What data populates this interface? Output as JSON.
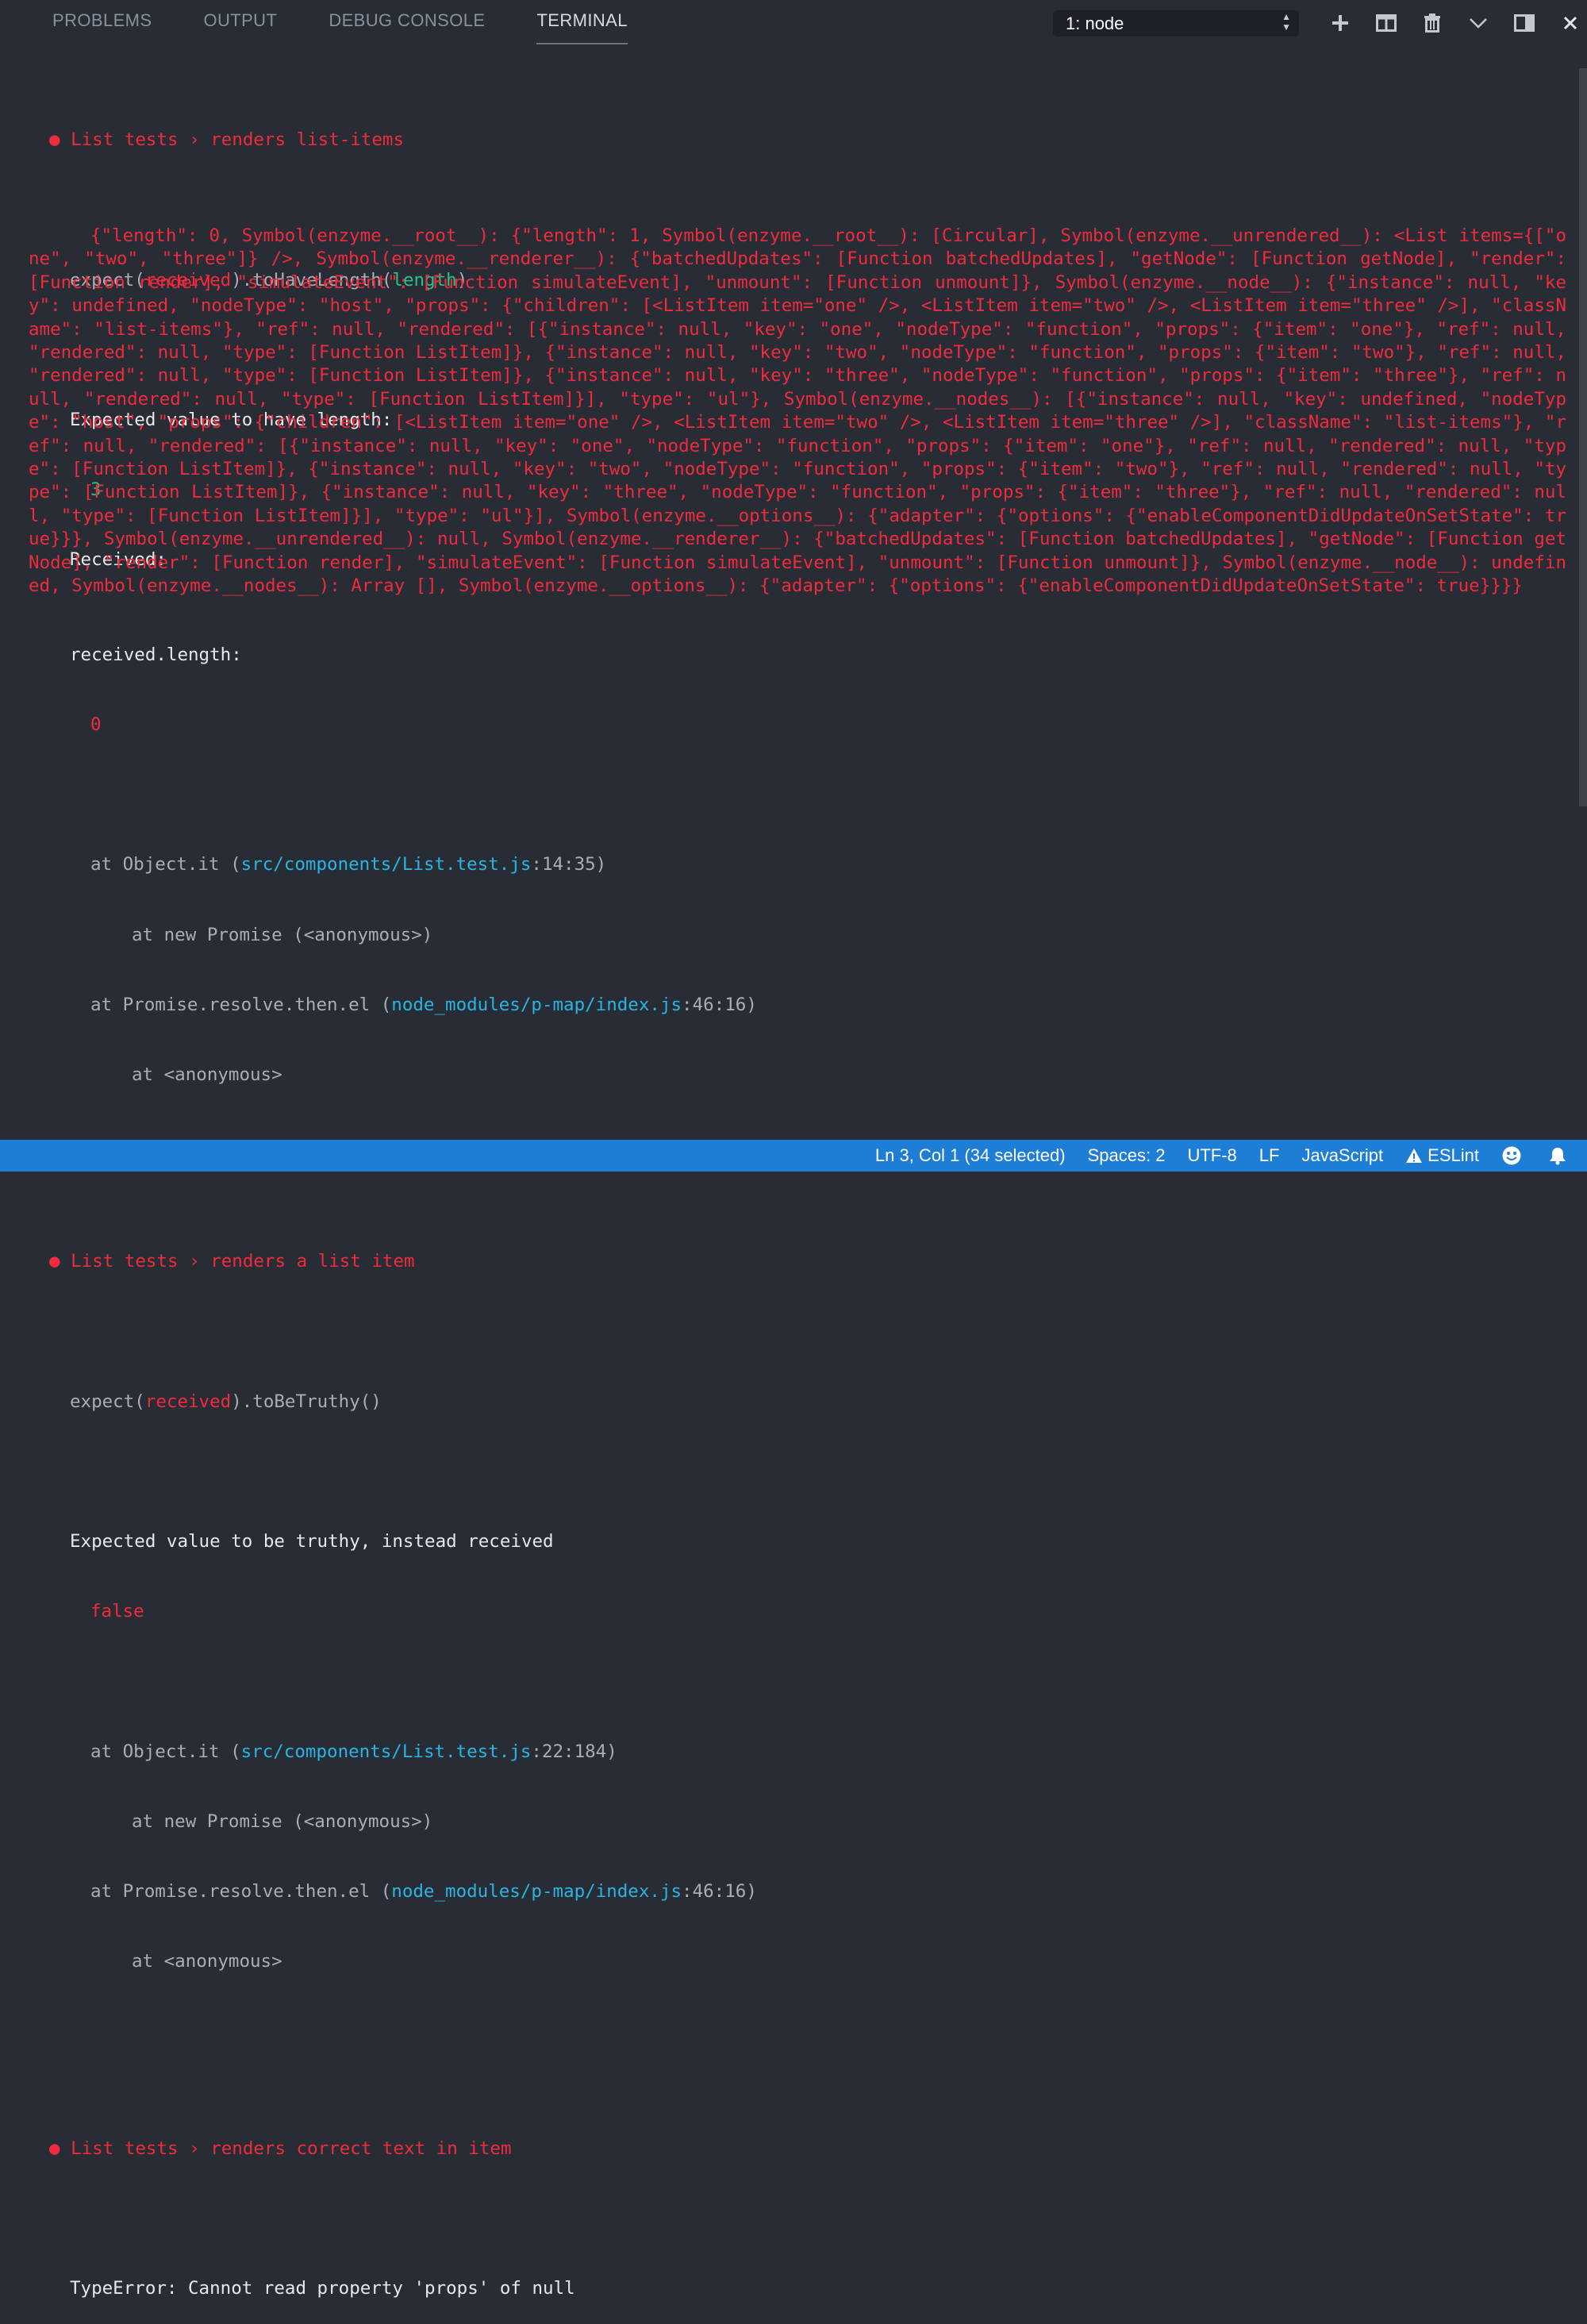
{
  "panel": {
    "tabs": [
      {
        "label": "PROBLEMS"
      },
      {
        "label": "OUTPUT"
      },
      {
        "label": "DEBUG CONSOLE"
      },
      {
        "label": "TERMINAL",
        "active": true
      }
    ],
    "terminal_select": {
      "value": "1: node"
    },
    "actions": [
      "plus-icon",
      "split-terminal-icon",
      "trash-icon",
      "chevron-down-icon",
      "maximize-panel-icon",
      "close-icon"
    ]
  },
  "terminal": {
    "test1": {
      "bullet": "●",
      "title": "List tests › renders list-items",
      "expect_prefix": "expect(",
      "expect_received": "received",
      "expect_mid": ").toHaveLength(",
      "expect_arg": "length",
      "expect_suffix": ")",
      "expected_label": "Expected value to have length:",
      "expected_value": "3",
      "received_label": "Received:",
      "received_value": "{\"length\": 0, Symbol(enzyme.__root__): {\"length\": 1, Symbol(enzyme.__root__): [Circular], Symbol(enzyme.__unrendered__): <List items={[\"one\", \"two\", \"three\"]} />, Symbol(enzyme.__renderer__): {\"batchedUpdates\": [Function batchedUpdates], \"getNode\": [Function getNode], \"render\": [Function render], \"simulateEvent\": [Function simulateEvent], \"unmount\": [Function unmount]}, Symbol(enzyme.__node__): {\"instance\": null, \"key\": undefined, \"nodeType\": \"host\", \"props\": {\"children\": [<ListItem item=\"one\" />, <ListItem item=\"two\" />, <ListItem item=\"three\" />], \"className\": \"list-items\"}, \"ref\": null, \"rendered\": [{\"instance\": null, \"key\": \"one\", \"nodeType\": \"function\", \"props\": {\"item\": \"one\"}, \"ref\": null, \"rendered\": null, \"type\": [Function ListItem]}, {\"instance\": null, \"key\": \"two\", \"nodeType\": \"function\", \"props\": {\"item\": \"two\"}, \"ref\": null, \"rendered\": null, \"type\": [Function ListItem]}, {\"instance\": null, \"key\": \"three\", \"nodeType\": \"function\", \"props\": {\"item\": \"three\"}, \"ref\": null, \"rendered\": null, \"type\": [Function ListItem]}], \"type\": \"ul\"}, Symbol(enzyme.__nodes__): [{\"instance\": null, \"key\": undefined, \"nodeType\": \"host\", \"props\": {\"children\": [<ListItem item=\"one\" />, <ListItem item=\"two\" />, <ListItem item=\"three\" />], \"className\": \"list-items\"}, \"ref\": null, \"rendered\": [{\"instance\": null, \"key\": \"one\", \"nodeType\": \"function\", \"props\": {\"item\": \"one\"}, \"ref\": null, \"rendered\": null, \"type\": [Function ListItem]}, {\"instance\": null, \"key\": \"two\", \"nodeType\": \"function\", \"props\": {\"item\": \"two\"}, \"ref\": null, \"rendered\": null, \"type\": [Function ListItem]}, {\"instance\": null, \"key\": \"three\", \"nodeType\": \"function\", \"props\": {\"item\": \"three\"}, \"ref\": null, \"rendered\": null, \"type\": [Function ListItem]}], \"type\": \"ul\"}], Symbol(enzyme.__options__): {\"adapter\": {\"options\": {\"enableComponentDidUpdateOnSetState\": true}}}, Symbol(enzyme.__unrendered__): null, Symbol(enzyme.__renderer__): {\"batchedUpdates\": [Function batchedUpdates], \"getNode\": [Function getNode], \"render\": [Function render], \"simulateEvent\": [Function simulateEvent], \"unmount\": [Function unmount]}, Symbol(enzyme.__node__): undefined, Symbol(enzyme.__nodes__): Array [], Symbol(enzyme.__options__): {\"adapter\": {\"options\": {\"enableComponentDidUpdateOnSetState\": true}}}}",
      "length_label": "received.length:",
      "length_value": "0",
      "stack": [
        {
          "prefix": "at Object.it (",
          "link": "src/components/List.test.js",
          "suffix": ":14:35)"
        },
        {
          "prefix": "at new Promise (<anonymous>)"
        },
        {
          "prefix": "at Promise.resolve.then.el (",
          "link": "node_modules/p-map/index.js",
          "suffix": ":46:16)"
        },
        {
          "prefix": "at <anonymous>"
        }
      ]
    },
    "test2": {
      "bullet": "●",
      "title": "List tests › renders a list item",
      "expect_prefix": "expect(",
      "expect_received": "received",
      "expect_suffix": ").toBeTruthy()",
      "expected_label": "Expected value to be truthy, instead received",
      "received_value": "false",
      "stack": [
        {
          "prefix": "at Object.it (",
          "link": "src/components/List.test.js",
          "suffix": ":22:184)"
        },
        {
          "prefix": "at new Promise (<anonymous>)"
        },
        {
          "prefix": "at Promise.resolve.then.el (",
          "link": "node_modules/p-map/index.js",
          "suffix": ":46:16)"
        },
        {
          "prefix": "at <anonymous>"
        }
      ]
    },
    "test3": {
      "bullet": "●",
      "title": "List tests › renders correct text in item",
      "error": "TypeError: Cannot read property 'props' of null"
    }
  },
  "statusbar": {
    "cursor": "Ln 3, Col 1 (34 selected)",
    "spaces": "Spaces: 2",
    "encoding": "UTF-8",
    "eol": "LF",
    "language": "JavaScript",
    "eslint": "ESLint"
  },
  "colors": {
    "background": "#282c34",
    "error_red": "#ef2b3d",
    "success_green": "#25c38b",
    "link_blue": "#29b4e3",
    "statusbar_blue": "#1e7dd4"
  }
}
